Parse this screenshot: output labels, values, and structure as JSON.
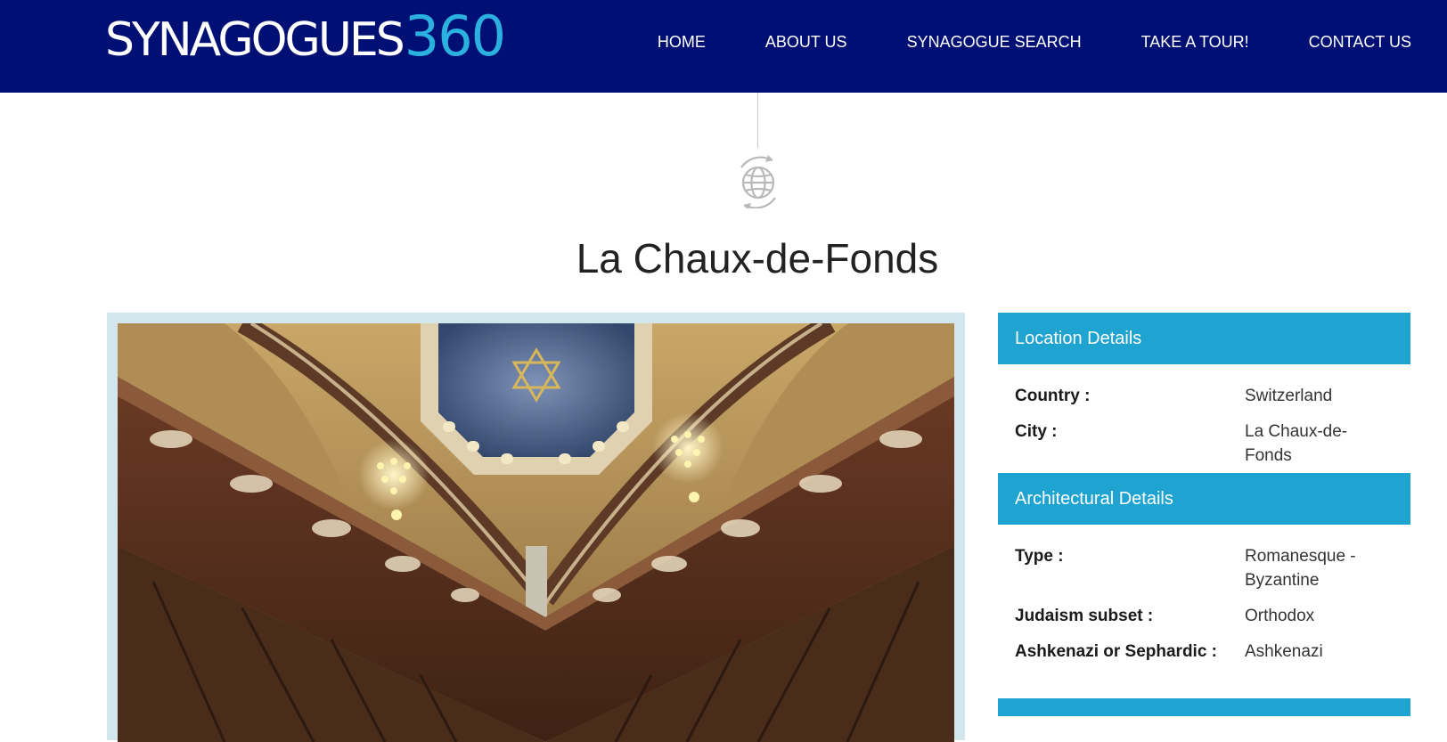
{
  "header": {
    "logo_word": "SYNAGOGUES",
    "logo_number": "360",
    "nav": [
      "HOME",
      "ABOUT US",
      "SYNAGOGUE SEARCH",
      "TAKE A TOUR!",
      "CONTACT US"
    ]
  },
  "page": {
    "title": "La Chaux-de-Fonds"
  },
  "location": {
    "heading": "Location Details",
    "rows": [
      {
        "label": "Country :",
        "value": "Switzerland"
      },
      {
        "label": "City :",
        "value": "La Chaux-de-Fonds"
      }
    ]
  },
  "architecture": {
    "heading": "Architectural Details",
    "rows": [
      {
        "label": "Type :",
        "value": "Romanesque - Byzantine"
      },
      {
        "label": "Judaism subset :",
        "value": "Orthodox"
      },
      {
        "label": "Ashkenazi or Sephardic :",
        "value": "Ashkenazi"
      }
    ]
  },
  "colors": {
    "header_bg": "#000f73",
    "accent": "#1fa3d0",
    "logo_number": "#2bb1e0"
  },
  "icons": {
    "globe": "rotating-globe-icon"
  }
}
